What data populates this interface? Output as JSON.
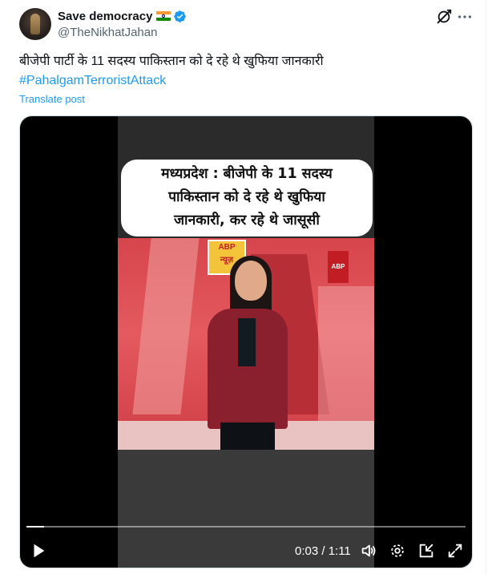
{
  "author": {
    "display_name": "Save democracy",
    "handle": "@TheNikhatJahan"
  },
  "tweet": {
    "text": "बीजेपी पार्टी के 11 सदस्य पाकिस्तान को दे रहे थे खुफिया जानकारी",
    "hashtag": "#PahalgamTerroristAttack",
    "translate_label": "Translate post"
  },
  "video": {
    "caption_line1": "मध्यप्रदेश : बीजेपी के 11 सदस्य",
    "caption_line2": "पाकिस्तान को दे रहे थे खुफिया",
    "caption_line3": "जानकारी, कर रहे थे जासूसी",
    "channel_logo": "ABP",
    "channel_logo_sub": "न्यूज़",
    "time_display": "0:03 / 1:11",
    "progress_fraction": 0.04
  },
  "icons": {
    "grok": "grok-icon",
    "more": "more-icon",
    "play": "play-icon",
    "volume": "volume-icon",
    "settings": "gear-icon",
    "pip": "pip-icon",
    "fullscreen": "fullscreen-icon",
    "verified": "verified-badge-icon",
    "flag": "india-flag-icon"
  },
  "colors": {
    "accent": "#1d9bf0",
    "text_secondary": "#536471",
    "text_primary": "#0f1419"
  }
}
